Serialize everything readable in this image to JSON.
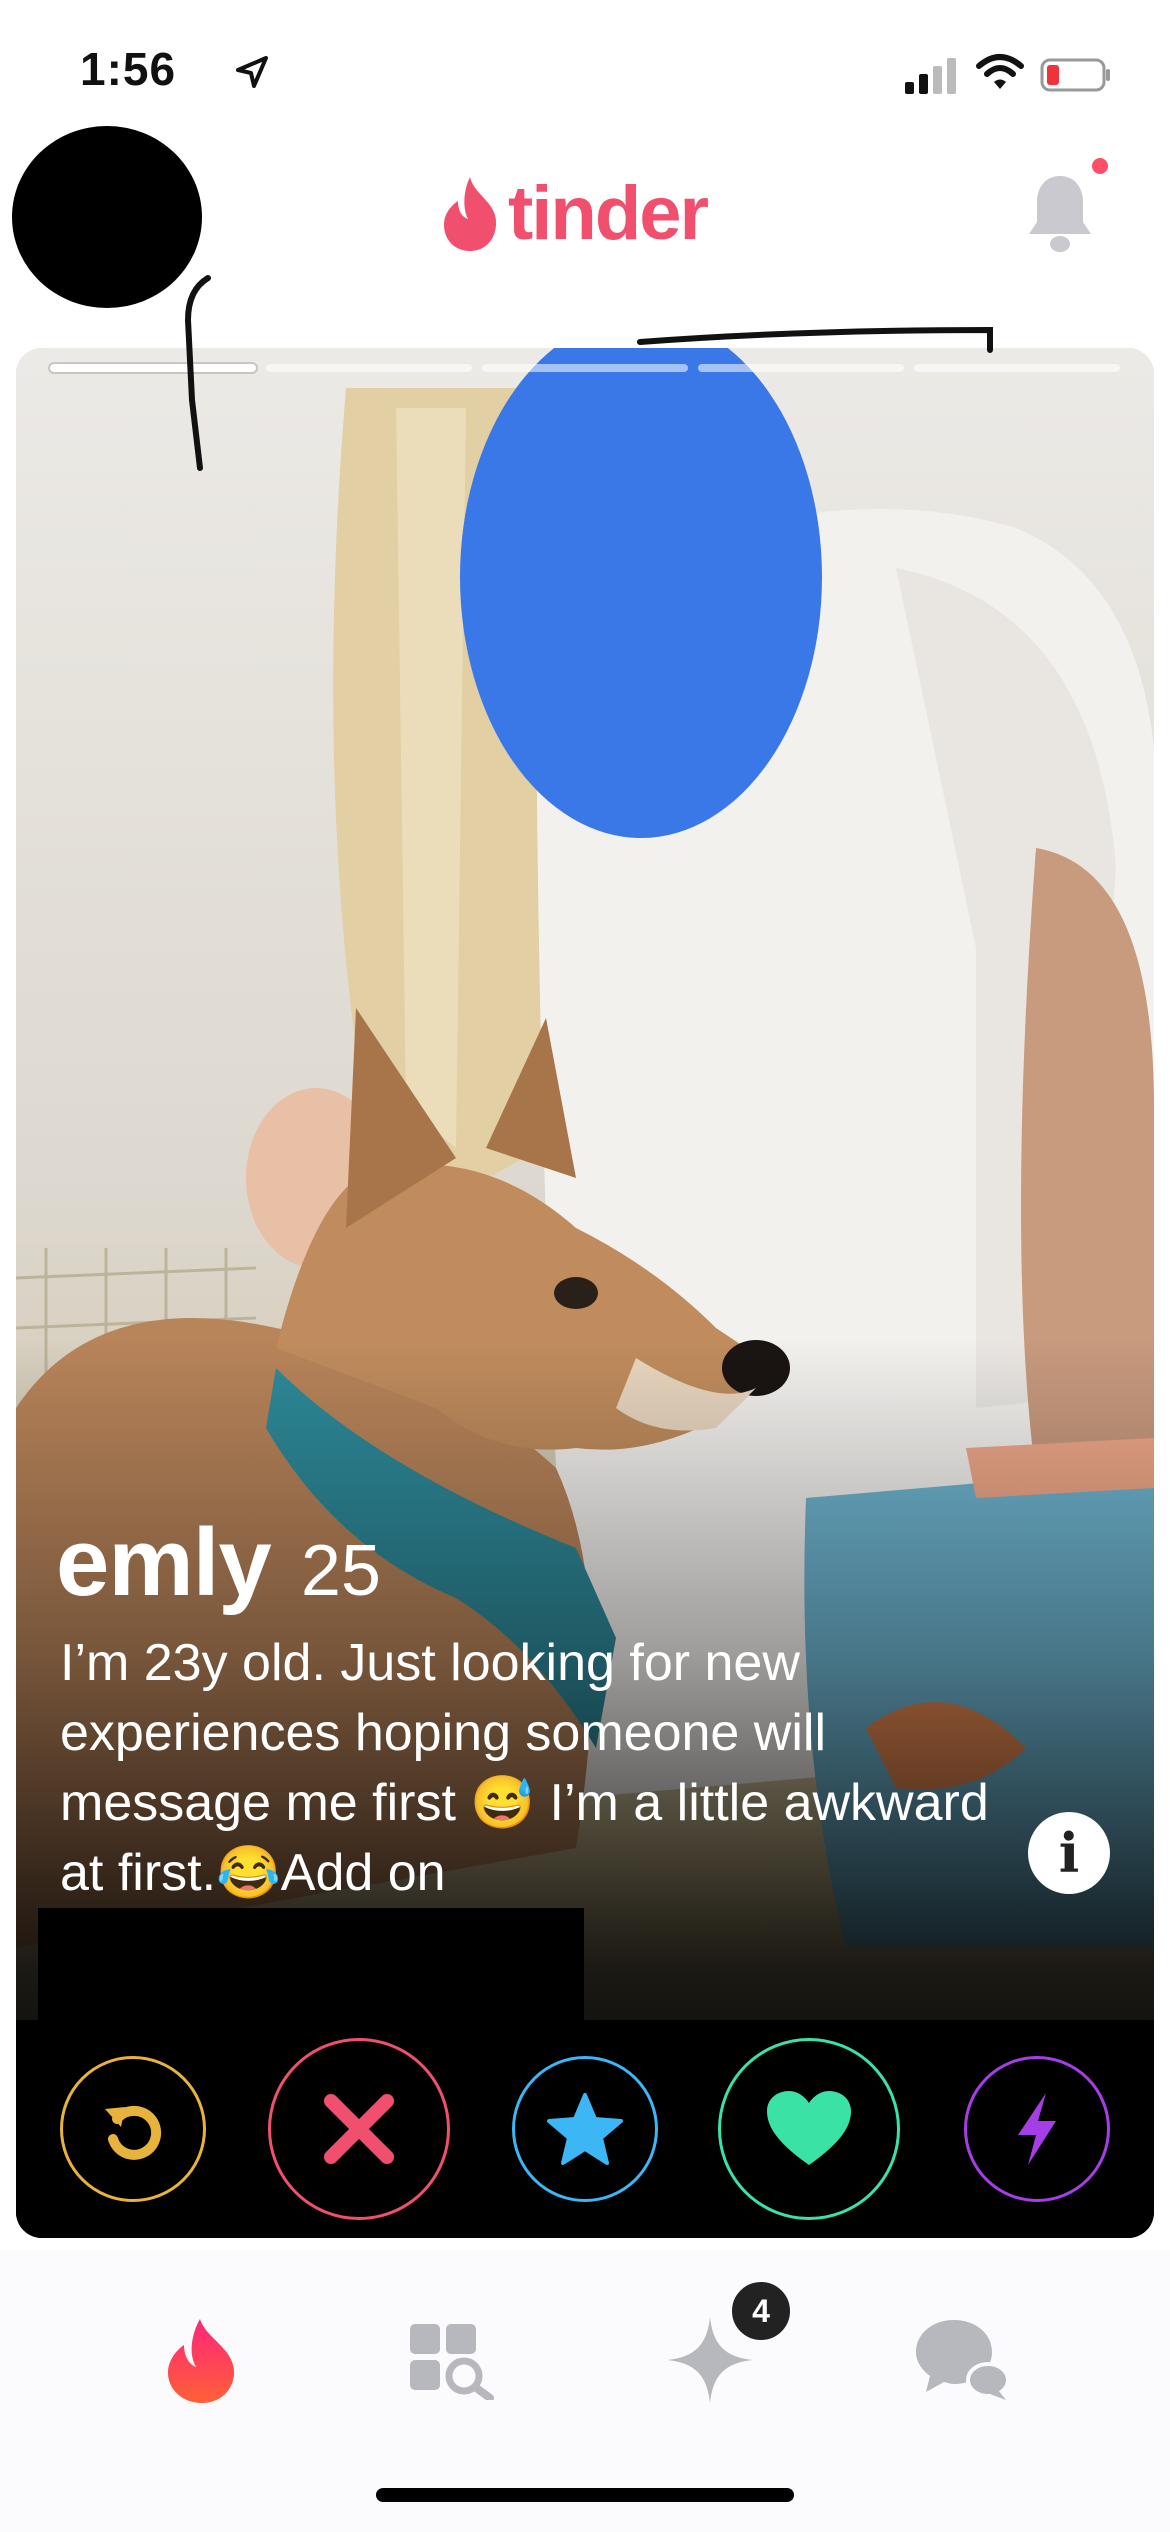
{
  "status_bar": {
    "time": "1:56"
  },
  "header": {
    "logo_text": "tinder",
    "brand_color": "#f0506e"
  },
  "card": {
    "photo_count": 5,
    "active_photo_index": 0,
    "name": "emly",
    "age": "25",
    "bio": "I’m 23y old. Just looking for new experiences hoping someone will message me first 😅 I’m a little awkward at first.😂Add on",
    "info_icon": "i"
  },
  "actions": [
    {
      "name": "rewind",
      "color": "#e8b33c",
      "icon": "rewind-icon"
    },
    {
      "name": "nope",
      "color": "#f0506e",
      "icon": "x-icon"
    },
    {
      "name": "super-like",
      "color": "#3cb6f5",
      "icon": "star-icon"
    },
    {
      "name": "like",
      "color": "#3be2a5",
      "icon": "heart-icon"
    },
    {
      "name": "boost",
      "color": "#a63ee8",
      "icon": "bolt-icon"
    }
  ],
  "tabbar": {
    "items": [
      "flame-icon",
      "explore-icon",
      "spark-icon",
      "chat-icon"
    ],
    "badge_count": "4"
  }
}
